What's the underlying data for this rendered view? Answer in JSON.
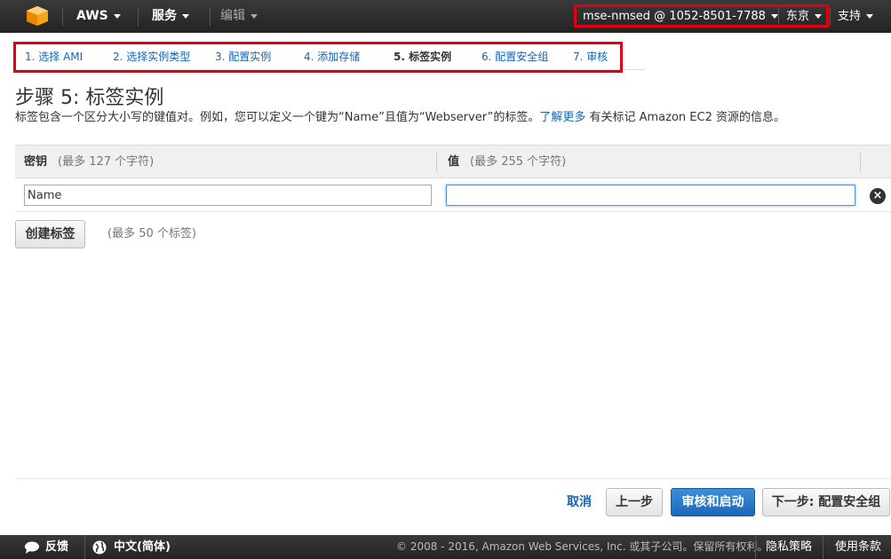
{
  "nav": {
    "aws_label": "AWS",
    "services_label": "服务",
    "edit_label": "编辑",
    "account_label": "mse-nmsed @ 1052-8501-7788",
    "region_label": "东京",
    "support_label": "支持"
  },
  "steps": [
    {
      "label": "1. 选择 AMI"
    },
    {
      "label": "2. 选择实例类型"
    },
    {
      "label": "3. 配置实例"
    },
    {
      "label": "4. 添加存储"
    },
    {
      "label": "5. 标签实例"
    },
    {
      "label": "6. 配置安全组"
    },
    {
      "label": "7. 审核"
    }
  ],
  "page": {
    "title": "步骤 5: 标签实例",
    "desc_before": "标签包含一个区分大小写的键值对。例如，您可以定义一个键为“Name”且值为“Webserver”的标签。",
    "desc_link": "了解更多",
    "desc_after": " 有关标记 Amazon EC2 资源的信息。"
  },
  "table": {
    "key_header": "密钥",
    "key_hint": "(最多 127 个字符)",
    "value_header": "值",
    "value_hint": "(最多 255 个字符)",
    "row": {
      "key": "Name",
      "value": ""
    }
  },
  "create_tag": {
    "label": "创建标签",
    "hint": "(最多 50 个标签)"
  },
  "actions": {
    "cancel": "取消",
    "previous": "上一步",
    "review_launch": "审核和启动",
    "next": "下一步: 配置安全组"
  },
  "footer": {
    "feedback": "反馈",
    "language": "中文(简体)",
    "copyright": "© 2008 - 2016, Amazon Web Services, Inc. 或其子公司。保留所有权利。",
    "privacy": "隐私策略",
    "terms": "使用条款"
  },
  "colors": {
    "accent": "#1166bb",
    "highlight": "#e00014",
    "primary_button": "#1a67b8"
  }
}
